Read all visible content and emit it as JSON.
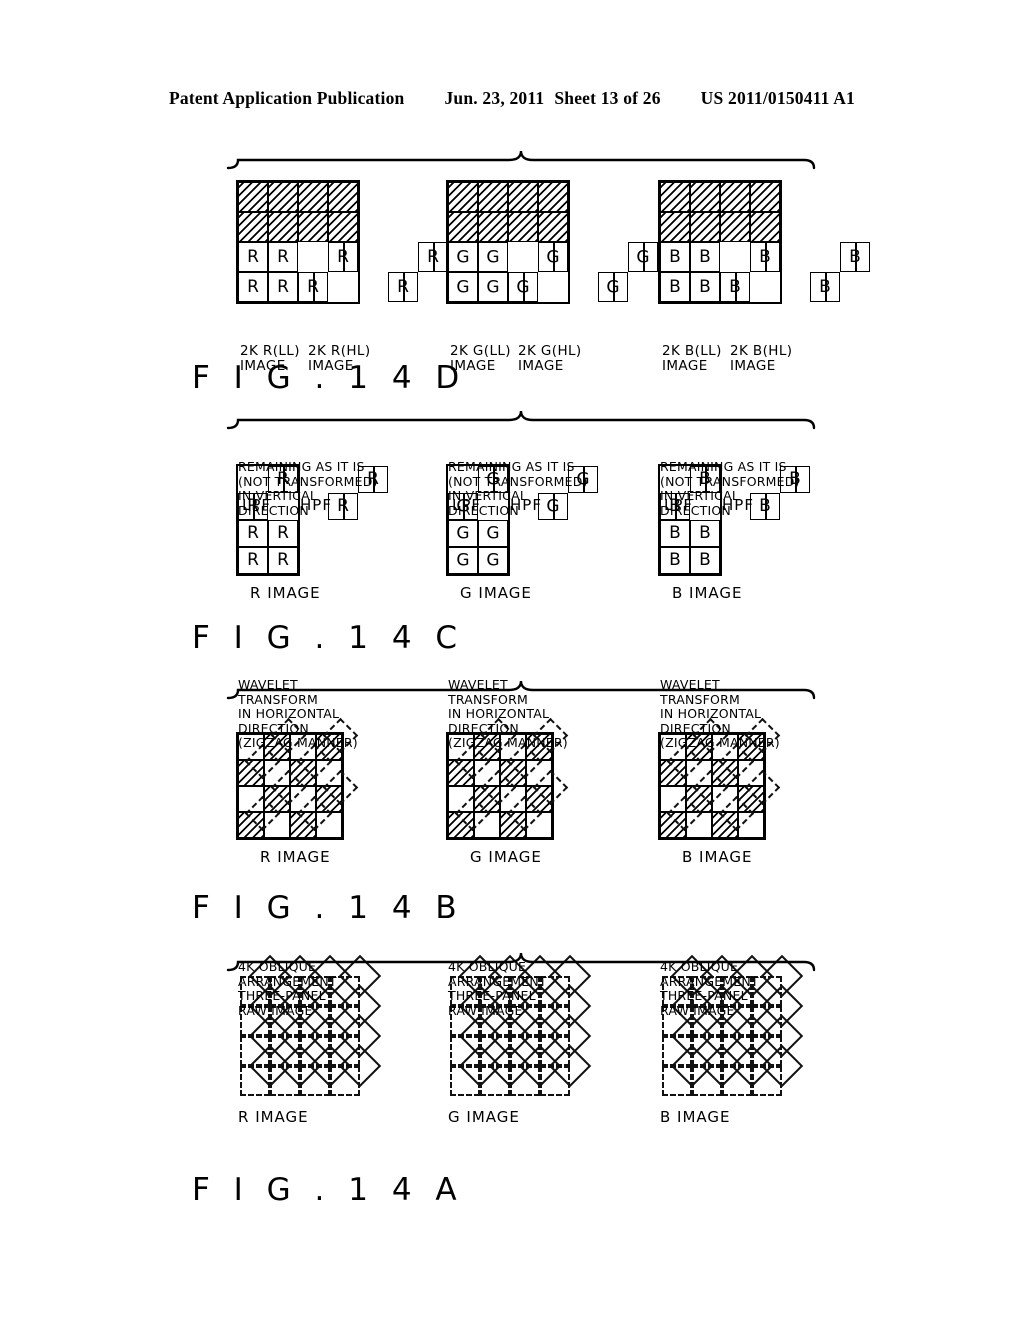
{
  "header": {
    "publication": "Patent Application Publication",
    "date": "Jun. 23, 2011",
    "sheet": "Sheet 13 of 26",
    "number": "US 2011/0150411 A1"
  },
  "figures": [
    {
      "id": "fig14a",
      "title": "F I G . 1 4 A",
      "rows": [
        {
          "key": "r",
          "image_label": "R IMAGE",
          "annotation": [
            "4K OBLIQUE",
            "ARRANGEMENT",
            "THREE-PANEL",
            "RAW IMAGE"
          ]
        },
        {
          "key": "g",
          "image_label": "G IMAGE",
          "annotation": [
            "4K OBLIQUE",
            "ARRANGEMENT",
            "THREE-PANEL",
            "RAW IMAGE"
          ]
        },
        {
          "key": "b",
          "image_label": "B IMAGE",
          "annotation": [
            "4K OBLIQUE",
            "ARRANGEMENT",
            "THREE-PANEL",
            "RAW IMAGE"
          ]
        }
      ]
    },
    {
      "id": "fig14b",
      "title": "F I G . 1 4 B",
      "rows": [
        {
          "key": "r",
          "image_label": "R IMAGE",
          "annotation": [
            "WAVELET",
            "TRANSFORM",
            "IN HORIZONTAL",
            "DIRECTION",
            "(ZIGZAG MANNER)"
          ]
        },
        {
          "key": "g",
          "image_label": "G IMAGE",
          "annotation": [
            "WAVELET",
            "TRANSFORM",
            "IN HORIZONTAL",
            "DIRECTION",
            "(ZIGZAG MANNER)"
          ]
        },
        {
          "key": "b",
          "image_label": "B IMAGE",
          "annotation": [
            "WAVELET",
            "TRANSFORM",
            "IN HORIZONTAL",
            "DIRECTION",
            "(ZIGZAG MANNER)"
          ]
        }
      ]
    },
    {
      "id": "fig14c",
      "title": "F I G . 1 4 C",
      "rows": [
        {
          "key": "r",
          "image_label": "R IMAGE",
          "letter": "R",
          "filter_labels": [
            "LPF",
            "HPF"
          ],
          "annotation": [
            "REMAINING AS IT IS",
            "(NOT TRANSFORMED)",
            "IN VERTICAL",
            "DIRECTION"
          ]
        },
        {
          "key": "g",
          "image_label": "G IMAGE",
          "letter": "G",
          "filter_labels": [
            "LPF",
            "HPF"
          ],
          "annotation": [
            "REMAINING AS IT IS",
            "(NOT TRANSFORMED)",
            "IN VERTICAL",
            "DIRECTION"
          ]
        },
        {
          "key": "b",
          "image_label": "B IMAGE",
          "letter": "B",
          "filter_labels": [
            "LPF",
            "HPF"
          ],
          "annotation": [
            "REMAINING AS IT IS",
            "(NOT TRANSFORMED)",
            "IN VERTICAL",
            "DIRECTION"
          ]
        }
      ]
    },
    {
      "id": "fig14d",
      "title": "F I G . 1 4 D",
      "rows": [
        {
          "key": "r",
          "letter": "R",
          "ll_label": [
            "2K R(LL)",
            "IMAGE"
          ],
          "hl_label": [
            "2K R(HL)",
            "IMAGE"
          ]
        },
        {
          "key": "g",
          "letter": "G",
          "ll_label": [
            "2K G(LL)",
            "IMAGE"
          ],
          "hl_label": [
            "2K G(HL)",
            "IMAGE"
          ]
        },
        {
          "key": "b",
          "letter": "B",
          "ll_label": [
            "2K B(LL)",
            "IMAGE"
          ],
          "hl_label": [
            "2K B(HL)",
            "IMAGE"
          ]
        }
      ]
    }
  ],
  "colors": {
    "ink": "#000000",
    "paper": "#ffffff"
  }
}
